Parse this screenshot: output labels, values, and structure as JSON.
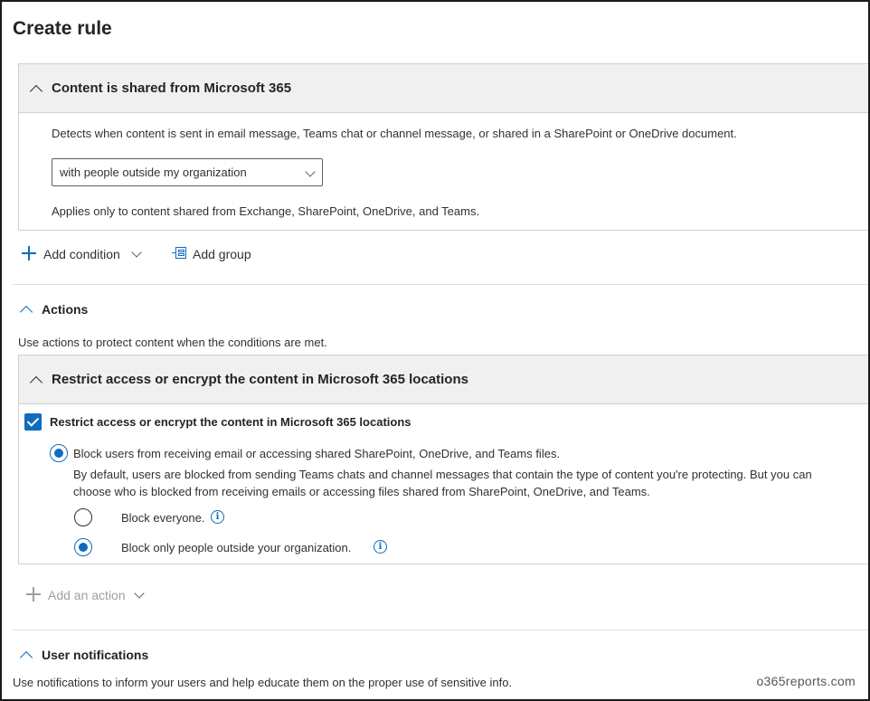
{
  "page": {
    "title": "Create rule"
  },
  "condition_card": {
    "title": "Content is shared from Microsoft 365",
    "description": "Detects when content is sent in email message, Teams chat or channel message, or shared in a SharePoint or OneDrive document.",
    "dropdown_value": "with people outside my organization",
    "note": "Applies only to content shared from Exchange, SharePoint, OneDrive, and Teams."
  },
  "condition_toolbar": {
    "add_condition_label": "Add condition",
    "add_group_label": "Add group"
  },
  "actions": {
    "heading": "Actions",
    "description": "Use actions to protect content when the conditions are met.",
    "card": {
      "title": "Restrict access or encrypt the content in Microsoft 365 locations",
      "checkbox_label": "Restrict access or encrypt the content in Microsoft 365 locations",
      "checkbox_checked": true,
      "option_block_label": "Block users from receiving email or accessing shared SharePoint, OneDrive, and Teams files.",
      "option_block_desc_line1": "By default, users are blocked from sending Teams chats and channel messages that contain the type of content you're protecting. But you can",
      "option_block_desc_line2": "choose who is blocked from receiving emails or accessing files shared from SharePoint, OneDrive, and Teams.",
      "sub_options": [
        {
          "label": "Block everyone.",
          "selected": false
        },
        {
          "label": "Block only people outside your organization.",
          "selected": true
        }
      ]
    },
    "add_action_label": "Add an action"
  },
  "user_notifications": {
    "heading": "User notifications",
    "description": "Use notifications to inform your users and help educate them on the proper use of sensitive info."
  },
  "watermark": "o365reports.com",
  "colors": {
    "accent": "#0f6cbd",
    "header_bg": "#f0f0f0",
    "border": "#d2d0ce",
    "disabled": "#a19f9d"
  }
}
